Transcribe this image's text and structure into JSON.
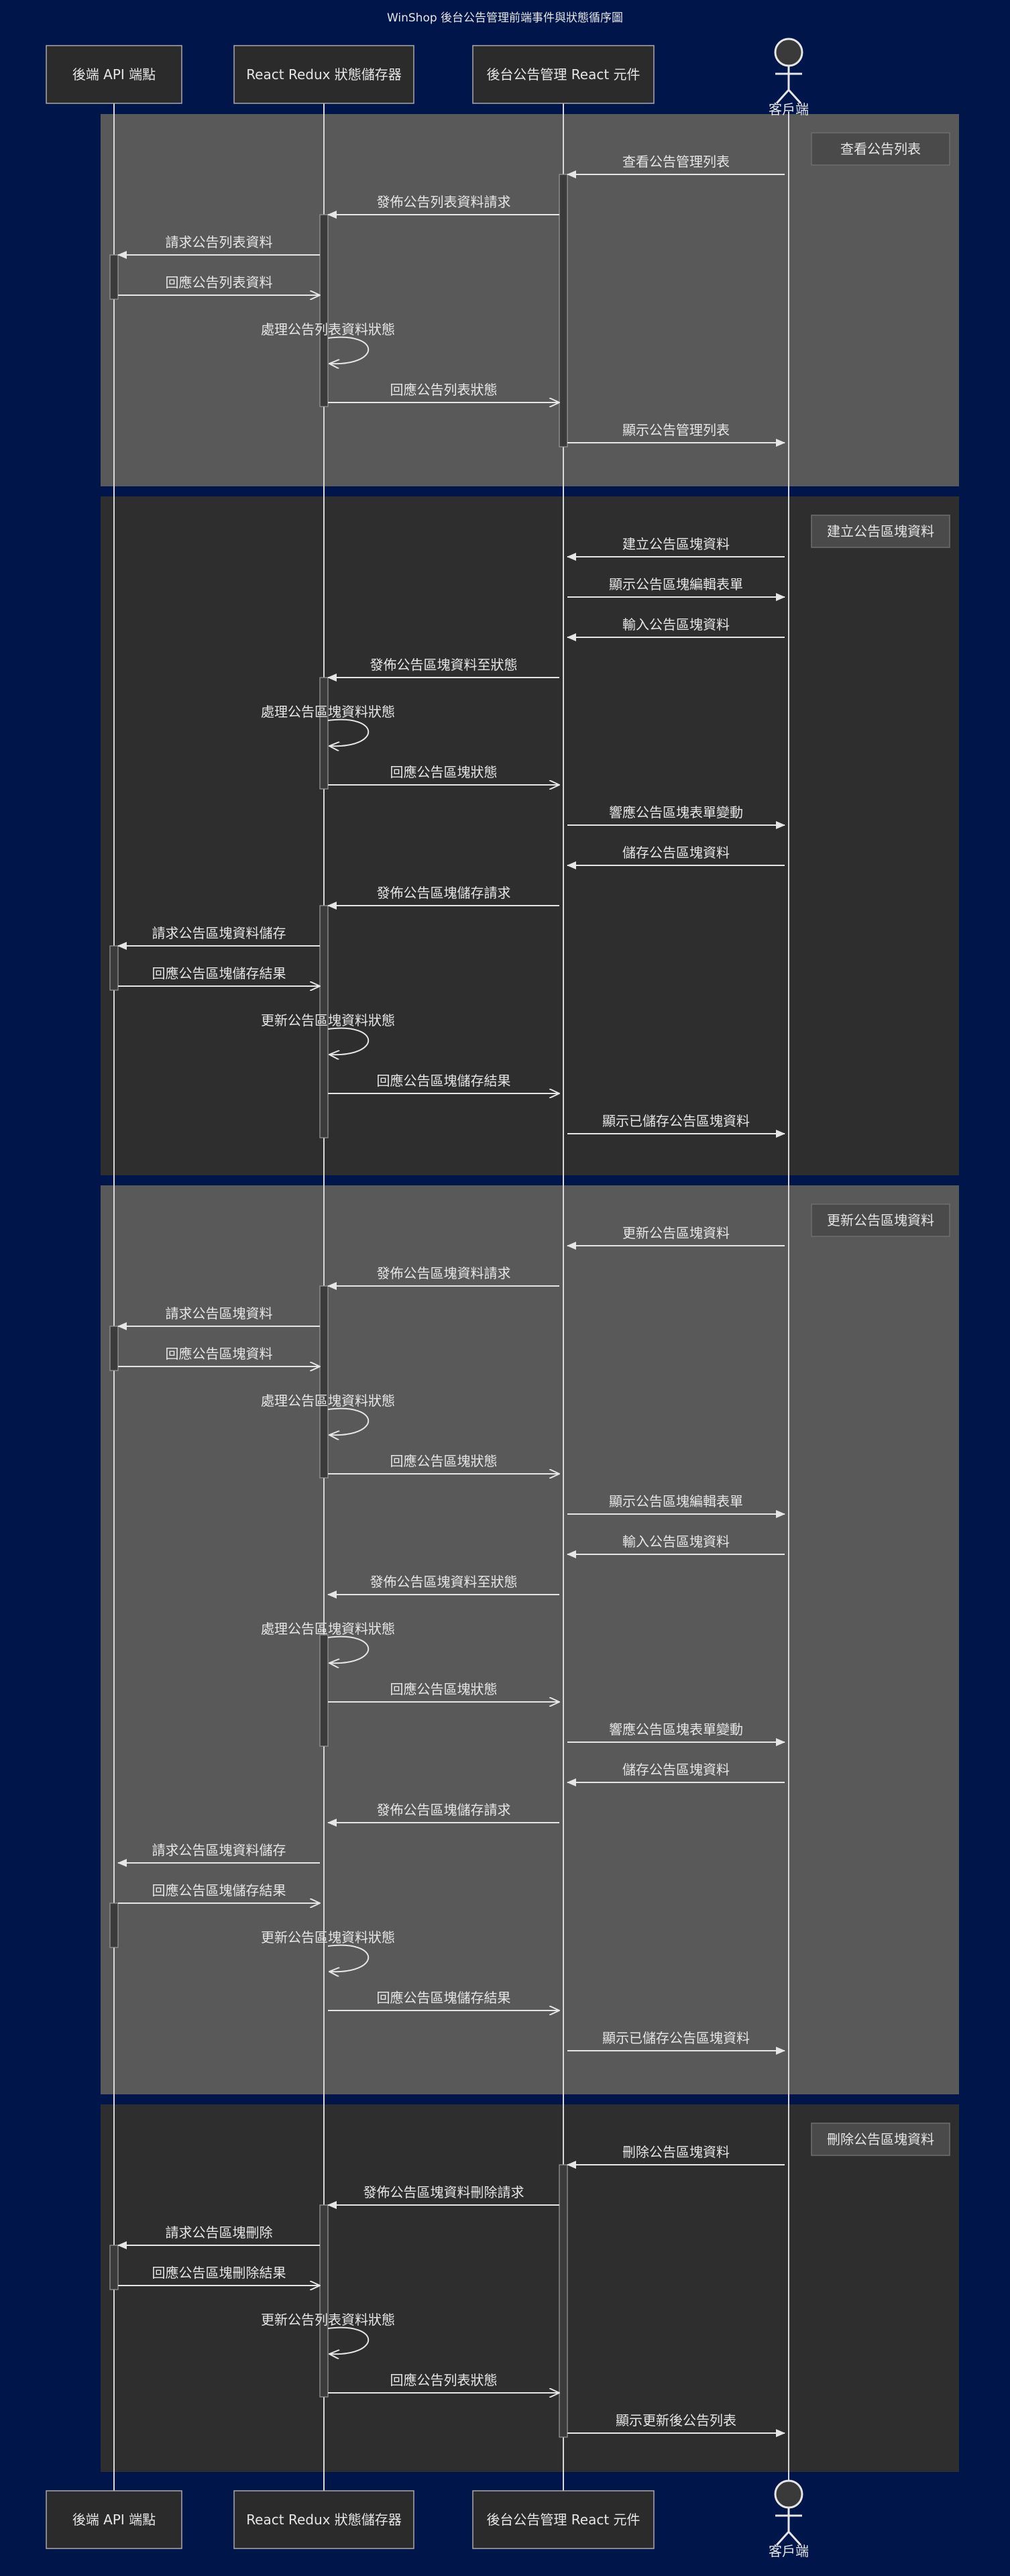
{
  "title": "WinShop 後台公告管理前端事件與狀態循序圖",
  "colors": {
    "background": "#00154a",
    "participant_fill": "#2b2b2b",
    "participant_border": "#aaaaaa",
    "text": "#e6e6e6",
    "line": "#e6e6e6",
    "section_light": "#595959",
    "section_dark": "#2e2e2e",
    "section_label_fill": "#4a4a4a"
  },
  "participants": [
    {
      "id": "api",
      "label": "後端 API 端點",
      "kind": "box"
    },
    {
      "id": "redux",
      "label": "React Redux 狀態儲存器",
      "kind": "box"
    },
    {
      "id": "ui",
      "label": "後台公告管理 React 元件",
      "kind": "box"
    },
    {
      "id": "client",
      "label": "客戶端",
      "kind": "actor"
    }
  ],
  "sections": [
    {
      "label": "查看公告列表",
      "shade": "light",
      "activations": [
        {
          "p": "ui",
          "from": 0,
          "to": 6
        },
        {
          "p": "redux",
          "from": 1,
          "to": 5
        },
        {
          "p": "api",
          "from": 2,
          "to": 3
        }
      ],
      "messages": [
        {
          "from": "client",
          "to": "ui",
          "text": "查看公告管理列表"
        },
        {
          "from": "ui",
          "to": "redux",
          "text": "發佈公告列表資料請求"
        },
        {
          "from": "redux",
          "to": "api",
          "text": "請求公告列表資料"
        },
        {
          "from": "api",
          "to": "redux",
          "text": "回應公告列表資料"
        },
        {
          "from": "redux",
          "to": "redux",
          "text": "處理公告列表資料狀態"
        },
        {
          "from": "redux",
          "to": "ui",
          "text": "回應公告列表狀態"
        },
        {
          "from": "ui",
          "to": "client",
          "text": "顯示公告管理列表"
        }
      ]
    },
    {
      "label": "建立公告區塊資料",
      "shade": "dark",
      "activations": [
        {
          "p": "ui",
          "from": 0,
          "to": 14
        },
        {
          "p": "redux",
          "from": 3,
          "to": 5
        },
        {
          "p": "redux",
          "from": 8,
          "to": 13
        },
        {
          "p": "api",
          "from": 9,
          "to": 10
        }
      ],
      "messages": [
        {
          "from": "client",
          "to": "ui",
          "text": "建立公告區塊資料"
        },
        {
          "from": "ui",
          "to": "client",
          "text": "顯示公告區塊編輯表單"
        },
        {
          "from": "client",
          "to": "ui",
          "text": "輸入公告區塊資料"
        },
        {
          "from": "ui",
          "to": "redux",
          "text": "發佈公告區塊資料至狀態"
        },
        {
          "from": "redux",
          "to": "redux",
          "text": "處理公告區塊資料狀態"
        },
        {
          "from": "redux",
          "to": "ui",
          "text": "回應公告區塊狀態"
        },
        {
          "from": "ui",
          "to": "client",
          "text": "響應公告區塊表單變動"
        },
        {
          "from": "client",
          "to": "ui",
          "text": "儲存公告區塊資料"
        },
        {
          "from": "ui",
          "to": "redux",
          "text": "發佈公告區塊儲存請求"
        },
        {
          "from": "redux",
          "to": "api",
          "text": "請求公告區塊資料儲存"
        },
        {
          "from": "api",
          "to": "redux",
          "text": "回應公告區塊儲存結果"
        },
        {
          "from": "redux",
          "to": "redux",
          "text": "更新公告區塊資料狀態"
        },
        {
          "from": "redux",
          "to": "ui",
          "text": "回應公告區塊儲存結果"
        },
        {
          "from": "ui",
          "to": "client",
          "text": "顯示已儲存公告區塊資料"
        }
      ]
    },
    {
      "label": "更新公告區塊資料",
      "shade": "light",
      "activations": [
        {
          "p": "ui",
          "from": 0,
          "to": 20
        },
        {
          "p": "redux",
          "from": 1,
          "to": 5
        },
        {
          "p": "api",
          "from": 2,
          "to": 3
        },
        {
          "p": "redux",
          "from": 9,
          "to": 11
        },
        {
          "p": "redux",
          "from": 14,
          "to": 19
        },
        {
          "p": "api",
          "from": 15,
          "to": 16
        }
      ],
      "messages": [
        {
          "from": "client",
          "to": "ui",
          "text": "更新公告區塊資料"
        },
        {
          "from": "ui",
          "to": "redux",
          "text": "發佈公告區塊資料請求"
        },
        {
          "from": "redux",
          "to": "api",
          "text": "請求公告區塊資料"
        },
        {
          "from": "api",
          "to": "redux",
          "text": "回應公告區塊資料"
        },
        {
          "from": "redux",
          "to": "redux",
          "text": "處理公告區塊資料狀態"
        },
        {
          "from": "redux",
          "to": "ui",
          "text": "回應公告區塊狀態"
        },
        {
          "from": "ui",
          "to": "client",
          "text": "顯示公告區塊編輯表單"
        },
        {
          "from": "client",
          "to": "ui",
          "text": "輸入公告區塊資料"
        },
        {
          "from": "ui",
          "to": "redux",
          "text": "發佈公告區塊資料至狀態"
        },
        {
          "from": "redux",
          "to": "redux",
          "text": "處理公告區塊資料狀態"
        },
        {
          "from": "redux",
          "to": "ui",
          "text": "回應公告區塊狀態"
        },
        {
          "from": "ui",
          "to": "client",
          "text": "響應公告區塊表單變動"
        },
        {
          "from": "client",
          "to": "ui",
          "text": "儲存公告區塊資料"
        },
        {
          "from": "ui",
          "to": "redux",
          "text": "發佈公告區塊儲存請求"
        },
        {
          "from": "redux",
          "to": "api",
          "text": "請求公告區塊資料儲存"
        },
        {
          "from": "api",
          "to": "redux",
          "text": "回應公告區塊儲存結果"
        },
        {
          "from": "redux",
          "to": "redux",
          "text": "更新公告區塊資料狀態"
        },
        {
          "from": "redux",
          "to": "ui",
          "text": "回應公告區塊儲存結果"
        },
        {
          "from": "ui",
          "to": "client",
          "text": "顯示已儲存公告區塊資料"
        }
      ]
    },
    {
      "label": "刪除公告區塊資料",
      "shade": "dark",
      "activations": [
        {
          "p": "ui",
          "from": 0,
          "to": 6
        },
        {
          "p": "redux",
          "from": 1,
          "to": 5
        },
        {
          "p": "api",
          "from": 2,
          "to": 3
        }
      ],
      "messages": [
        {
          "from": "client",
          "to": "ui",
          "text": "刪除公告區塊資料"
        },
        {
          "from": "ui",
          "to": "redux",
          "text": "發佈公告區塊資料刪除請求"
        },
        {
          "from": "redux",
          "to": "api",
          "text": "請求公告區塊刪除"
        },
        {
          "from": "api",
          "to": "redux",
          "text": "回應公告區塊刪除結果"
        },
        {
          "from": "redux",
          "to": "redux",
          "text": "更新公告列表資料狀態"
        },
        {
          "from": "redux",
          "to": "ui",
          "text": "回應公告列表狀態"
        },
        {
          "from": "ui",
          "to": "client",
          "text": "顯示更新後公告列表"
        }
      ]
    }
  ]
}
